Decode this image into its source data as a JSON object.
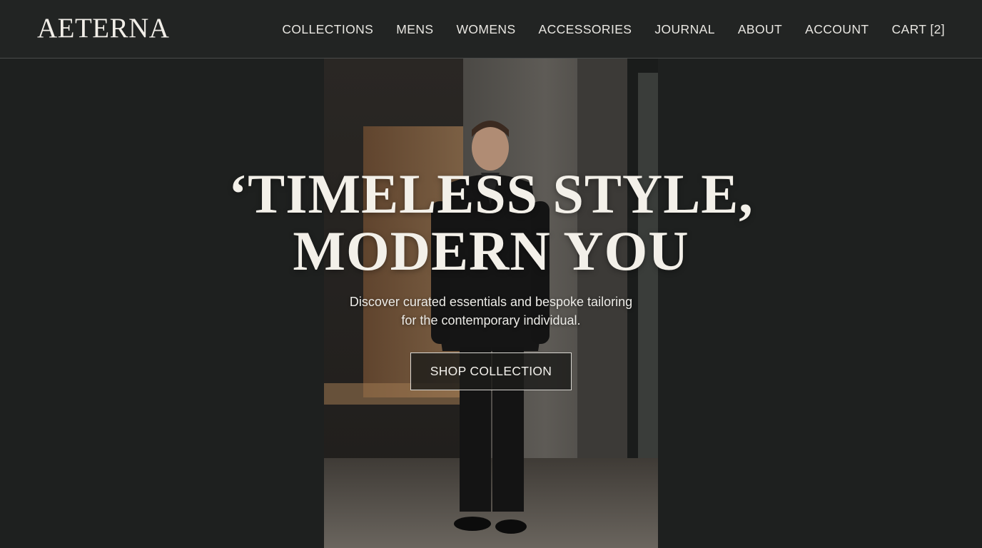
{
  "brand": {
    "name": "AETERNA"
  },
  "nav": {
    "items": [
      {
        "label": "COLLECTIONS"
      },
      {
        "label": "MENS"
      },
      {
        "label": "WOMENS"
      },
      {
        "label": "ACCESSORIES"
      },
      {
        "label": "JOURNAL"
      },
      {
        "label": "ABOUT"
      },
      {
        "label": "ACCOUNT"
      },
      {
        "label": "CART [2]"
      }
    ]
  },
  "hero": {
    "headline_line1": "‘TIMELESS STYLE,",
    "headline_line2": "MODERN YOU",
    "subtext_line1": "Discover curated essentials and bespoke tailoring",
    "subtext_line2": "for the contemporary individual.",
    "cta_label": "SHOP COLLECTION"
  },
  "colors": {
    "background": "#1e201f",
    "header": "#222423",
    "text": "#f1eee8",
    "divider": "#4a4c4b"
  }
}
